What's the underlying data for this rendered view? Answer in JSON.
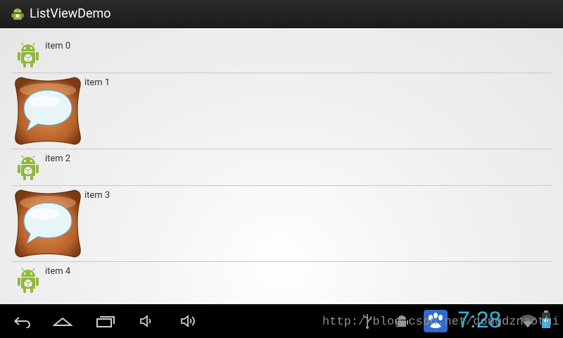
{
  "app": {
    "title": "ListViewDemo",
    "icon": "android-robot-icon"
  },
  "list": {
    "items": [
      {
        "label": "item 0",
        "icon": "android-robot-icon"
      },
      {
        "label": "item 1",
        "icon": "message-bubble-icon"
      },
      {
        "label": "item 2",
        "icon": "android-robot-icon"
      },
      {
        "label": "item 3",
        "icon": "message-bubble-icon"
      },
      {
        "label": "item 4",
        "icon": "android-robot-icon"
      }
    ]
  },
  "navigation": {
    "buttons": [
      "back-icon",
      "home-icon",
      "recent-apps-icon",
      "volume-down-icon",
      "volume-up-icon"
    ]
  },
  "status_bar": {
    "time": "7:28",
    "watermark": "http://blog.csdn.net/dongdznaotui",
    "icons": [
      "usb-icon",
      "android-debug-icon",
      "baidu-paw-icon",
      "wifi-icon",
      "battery-icon"
    ]
  },
  "colors": {
    "accent": "#33b5e5",
    "divider": "#c9c9c9",
    "android_green": "#8fb93b"
  }
}
